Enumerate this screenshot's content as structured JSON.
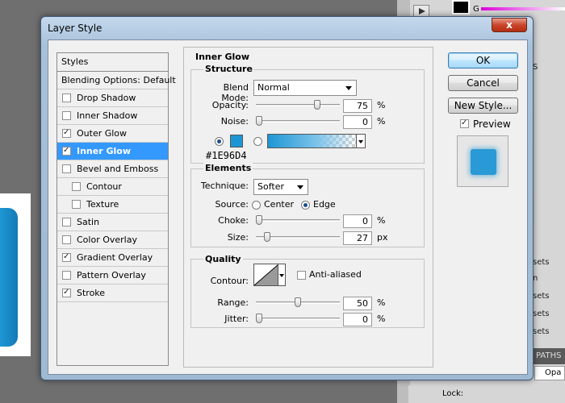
{
  "dialog": {
    "title": "Layer Style",
    "close_label": "x"
  },
  "styles_list": {
    "header": "Styles",
    "items": [
      {
        "label": "Blending Options: Default",
        "checkbox": false,
        "checked": false,
        "indent": false,
        "active": false
      },
      {
        "label": "Drop Shadow",
        "checkbox": true,
        "checked": false,
        "indent": false,
        "active": false
      },
      {
        "label": "Inner Shadow",
        "checkbox": true,
        "checked": false,
        "indent": false,
        "active": false
      },
      {
        "label": "Outer Glow",
        "checkbox": true,
        "checked": true,
        "indent": false,
        "active": false
      },
      {
        "label": "Inner Glow",
        "checkbox": true,
        "checked": true,
        "indent": false,
        "active": true
      },
      {
        "label": "Bevel and Emboss",
        "checkbox": true,
        "checked": false,
        "indent": false,
        "active": false
      },
      {
        "label": "Contour",
        "checkbox": true,
        "checked": false,
        "indent": true,
        "active": false
      },
      {
        "label": "Texture",
        "checkbox": true,
        "checked": false,
        "indent": true,
        "active": false
      },
      {
        "label": "Satin",
        "checkbox": true,
        "checked": false,
        "indent": false,
        "active": false
      },
      {
        "label": "Color Overlay",
        "checkbox": true,
        "checked": false,
        "indent": false,
        "active": false
      },
      {
        "label": "Gradient Overlay",
        "checkbox": true,
        "checked": true,
        "indent": false,
        "active": false
      },
      {
        "label": "Pattern Overlay",
        "checkbox": true,
        "checked": false,
        "indent": false,
        "active": false
      },
      {
        "label": "Stroke",
        "checkbox": true,
        "checked": true,
        "indent": false,
        "active": false
      }
    ]
  },
  "inner_glow": {
    "title": "Inner Glow",
    "structure": {
      "title": "Structure",
      "blend_mode_label": "Blend Mode:",
      "blend_mode_value": "Normal",
      "opacity_label": "Opacity:",
      "opacity_value": "75",
      "opacity_unit": "%",
      "opacity_level": 0.75,
      "noise_label": "Noise:",
      "noise_value": "0",
      "noise_unit": "%",
      "noise_level": 0,
      "color_hex_label": "#1E96D4",
      "color": "#1E96D4"
    },
    "elements": {
      "title": "Elements",
      "technique_label": "Technique:",
      "technique_value": "Softer",
      "source_label": "Source:",
      "source_center_label": "Center",
      "source_edge_label": "Edge",
      "choke_label": "Choke:",
      "choke_value": "0",
      "choke_unit": "%",
      "choke_level": 0,
      "size_label": "Size:",
      "size_value": "27",
      "size_unit": "px",
      "size_level": 0.108
    },
    "quality": {
      "title": "Quality",
      "contour_label": "Contour:",
      "anti_aliased_label": "Anti-aliased",
      "range_label": "Range:",
      "range_value": "50",
      "range_unit": "%",
      "range_level": 0.5,
      "jitter_label": "Jitter:",
      "jitter_value": "0",
      "jitter_unit": "%",
      "jitter_level": 0
    }
  },
  "buttons": {
    "ok_label": "OK",
    "cancel_label": "Cancel",
    "new_style_label": "New Style...",
    "preview_label": "Preview"
  },
  "background": {
    "g_label": "G",
    "side_texts": [
      "S",
      "sets",
      "n",
      "sets",
      "sets",
      "sets"
    ],
    "paths_label": "PATHS",
    "opacity_label": "Opa",
    "lock_label": "Lock:"
  },
  "colors": {
    "accent": "#3399FF",
    "glow": "#1E96D4"
  }
}
